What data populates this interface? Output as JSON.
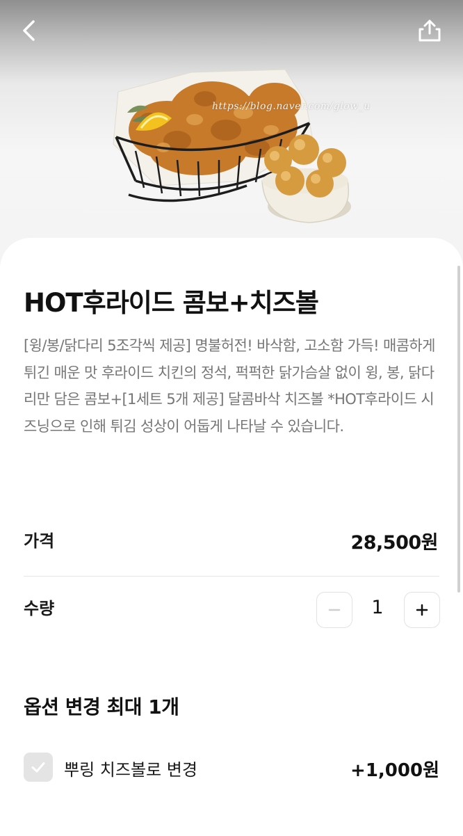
{
  "header": {
    "back_icon": "chevron-left-icon",
    "share_icon": "share-icon",
    "watermark": "https://blog.naver.com/glow_u"
  },
  "product": {
    "title": "HOT후라이드 콤보+치즈볼",
    "description": "[윙/봉/닭다리 5조각씩 제공] 명불허전! 바삭함, 고소함 가득! 매콤하게 튀긴 매운 맛 후라이드 치킨의 정석, 퍽퍽한 닭가슴살 없이 윙, 봉, 닭다리만 담은 콤보+[1세트 5개 제공] 달콤바삭 치즈볼 *HOT후라이드 시즈닝으로 인해 튀김 성상이 어둡게 나타날 수 있습니다."
  },
  "price": {
    "label": "가격",
    "value": "28,500원"
  },
  "quantity": {
    "label": "수량",
    "value": "1",
    "minus_icon": "minus-icon",
    "plus_icon": "plus-icon"
  },
  "options": {
    "section_title": "옵션 변경 최대 1개",
    "items": [
      {
        "label": "뿌링 치즈볼로 변경",
        "price": "+1,000원",
        "checked": false,
        "check_icon": "checkmark-icon"
      }
    ]
  },
  "colors": {
    "text_primary": "#111111",
    "text_secondary": "#767676",
    "divider": "#e6e6e6",
    "checkbox_bg": "#e4e4e4"
  }
}
